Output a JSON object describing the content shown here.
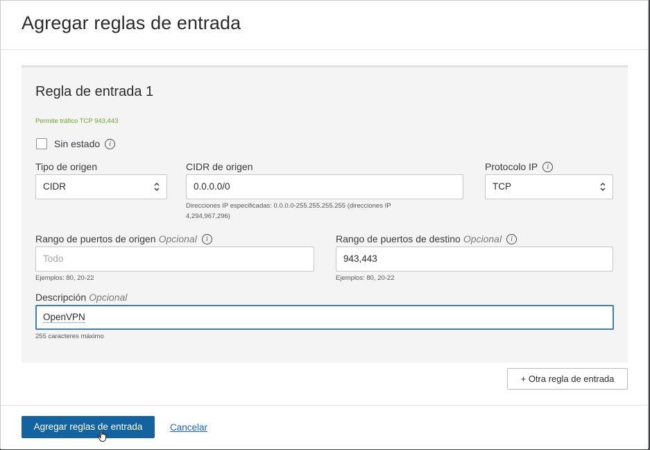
{
  "dialog": {
    "title": "Agregar reglas de entrada"
  },
  "rule": {
    "title": "Regla de entrada 1",
    "summary": "Permite tráfico TCP 943,443",
    "stateless_label": "Sin estado",
    "source_type": {
      "label": "Tipo de origen",
      "value": "CIDR"
    },
    "source_cidr": {
      "label": "CIDR de origen",
      "value": "0.0.0.0/0",
      "help_line1": "Direcciones IP especificadas: 0.0.0.0-255.255.255.255 (direcciones IP",
      "help_line2": "4,294,967,296)"
    },
    "ip_protocol": {
      "label": "Protocolo IP",
      "value": "TCP"
    },
    "source_port": {
      "label": "Rango de puertos de origen",
      "optional": "Opcional",
      "placeholder": "Todo",
      "help": "Ejemplos: 80, 20-22"
    },
    "dest_port": {
      "label": "Rango de puertos de destino",
      "optional": "Opcional",
      "value": "943,443",
      "help": "Ejemplos: 80, 20-22"
    },
    "description": {
      "label": "Descripción",
      "optional": "Opcional",
      "value": "OpenVPN",
      "help": "255 caracteres máximo"
    }
  },
  "add_another_label": "+ Otra regla de entrada",
  "footer": {
    "submit_label": "Agregar reglas de entrada",
    "cancel_label": "Cancelar"
  },
  "icons": {
    "info": "info-icon",
    "select": "select-arrows-icon",
    "cursor": "hand-pointer-icon"
  },
  "colors": {
    "primary": "#12639f",
    "hint_green": "#6aa524",
    "focus": "#3a7fc2",
    "link": "#1a63c4"
  }
}
